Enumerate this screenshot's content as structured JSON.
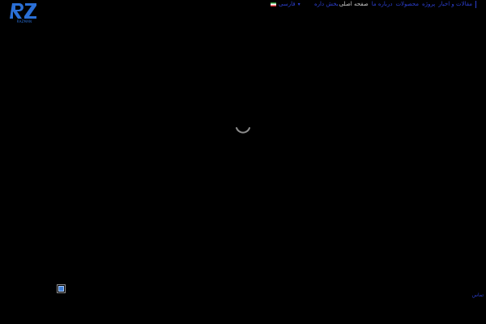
{
  "brand": {
    "logo_letters": "RZ",
    "logo_caption": "RAZMAN",
    "logo_color": "#2a6fd6"
  },
  "header": {
    "language": {
      "label": "فارسی",
      "flag_icon": "iran-flag-icon",
      "caret_icon": "chevron-down-icon"
    },
    "account_label": "بخش داره",
    "nav": {
      "items": [
        {
          "label": "صفحه اصلی",
          "state": "active"
        },
        {
          "label": "درباره ما",
          "state": "normal"
        },
        {
          "label": "محصولات",
          "state": "normal"
        },
        {
          "label": "پروژه",
          "state": "normal"
        },
        {
          "label": "مقالات و اخبار",
          "state": "normal"
        }
      ]
    }
  },
  "loader": {
    "icon": "loading-spinner-icon",
    "color": "#8c8c8c"
  },
  "chat": {
    "icon": "chat-icon",
    "color": "#3f7fd6"
  },
  "footer": {
    "link_label": "تماس"
  },
  "colors": {
    "background": "#000000",
    "link": "#2c3fd0",
    "active": "#c9c9c9"
  }
}
